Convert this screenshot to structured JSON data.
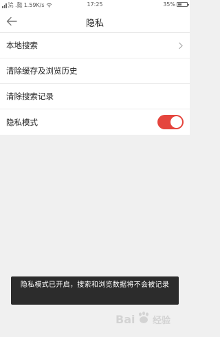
{
  "status_bar": {
    "carrier": "浣 .懿",
    "speed": "1.59K/s",
    "time": "17:25",
    "battery": "35%",
    "battery_level": 0.35
  },
  "nav": {
    "title": "隐私",
    "back_icon": "arrow-left-icon"
  },
  "settings": {
    "items": [
      {
        "label": "本地搜索",
        "control": "chevron"
      },
      {
        "label": "清除缓存及浏览历史",
        "control": "none"
      },
      {
        "label": "清除搜索记录",
        "control": "none"
      },
      {
        "label": "隐私模式",
        "control": "toggle",
        "on": true
      }
    ]
  },
  "toast": {
    "message": "隐私模式已开启，搜索和浏览数据将不会被记录"
  },
  "colors": {
    "accent": "#e5453d",
    "background": "#f0f0f0",
    "toast": "#2c2c2c"
  }
}
